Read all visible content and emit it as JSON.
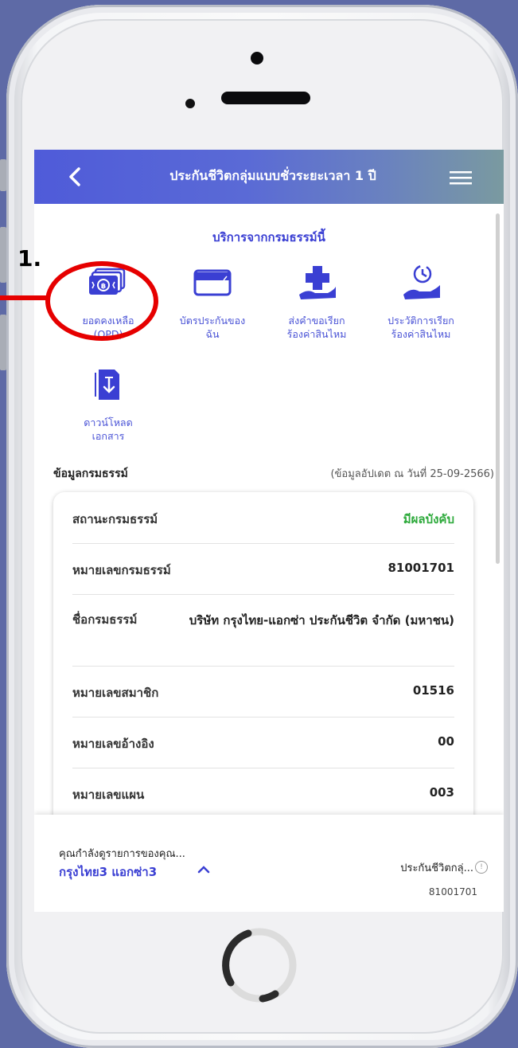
{
  "app": {
    "title": "ประกันชีวิตกลุ่มแบบชั่วระยะเวลา 1 ปี"
  },
  "services": {
    "section_title": "บริการจากกรมธรรม์นี้",
    "items": [
      {
        "label": "ยอดคงเหลือ\n(OPD)",
        "icon": "cash-stack-icon"
      },
      {
        "label": "บัตรประกันของ\nฉัน",
        "icon": "card-icon"
      },
      {
        "label": "ส่งคำขอเรียก\nร้องค่าสินไหม",
        "icon": "medical-claim-icon"
      },
      {
        "label": "ประวัติการเรียก\nร้องค่าสินไหม",
        "icon": "claim-history-icon"
      },
      {
        "label": "ดาวน์โหลด\nเอกสาร",
        "icon": "download-document-icon"
      }
    ]
  },
  "policy_info": {
    "header": "ข้อมูลกรมธรรม์",
    "updated": "(ข้อมูลอัปเดต ณ วันที่ 25-09-2566)",
    "rows": [
      {
        "label": "สถานะกรมธรรม์",
        "value": "มีผลบังคับ"
      },
      {
        "label": "หมายเลขกรมธรรม์",
        "value": "81001701"
      },
      {
        "label": "ชื่อกรมธรรม์",
        "value": "บริษัท กรุงไทย-แอกซ่า ประกันชีวิต จำกัด (มหาชน)"
      },
      {
        "label": "หมายเลขสมาชิก",
        "value": "01516"
      },
      {
        "label": "หมายเลขอ้างอิง",
        "value": "00"
      },
      {
        "label": "หมายเลขแผน",
        "value": "003"
      }
    ],
    "status_color": "#2eaa3c"
  },
  "bottom": {
    "viewing_text": "คุณกำลังดูรายการของคุณ...",
    "user_name": "กรุงไทย3 แอกซ่า3",
    "policy_short": "ประกันชีวิตกลุ่...",
    "policy_no": "81001701"
  },
  "annotation": {
    "number": "1.",
    "color": "#e60000"
  },
  "colors": {
    "accent": "#3a3fd3",
    "appbar_start": "#4f5bd9",
    "appbar_end": "#7a9aa0",
    "background": "#5e6aa6"
  }
}
